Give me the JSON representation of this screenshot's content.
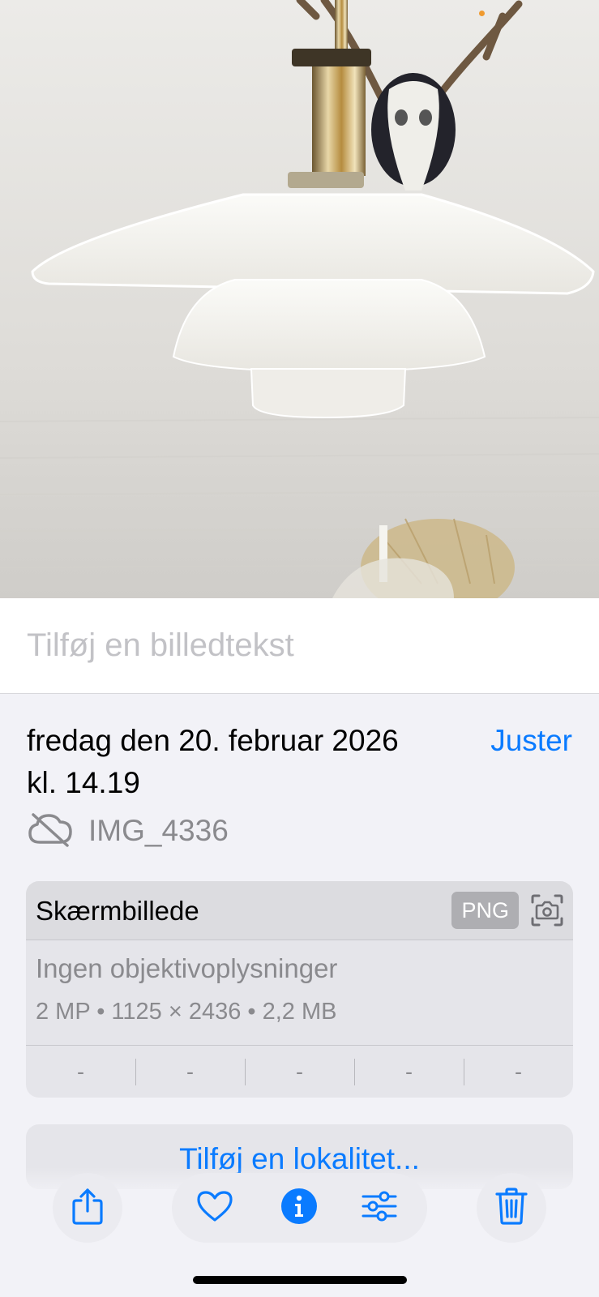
{
  "photo": {
    "description_icon": "pendant-lamp-photo"
  },
  "caption": {
    "placeholder": "Tilføj en billedtekst"
  },
  "info": {
    "date_line1": "fredag den 20. februar 2026",
    "date_line2": "kl. 14.19",
    "adjust_label": "Juster",
    "file_name": "IMG_4336"
  },
  "metadata": {
    "title": "Skærmbillede",
    "format_badge": "PNG",
    "lens": "Ingen objektivoplysninger",
    "specs": "2 MP • 1125 × 2436 • 2,2 MB",
    "exif": [
      "-",
      "-",
      "-",
      "-",
      "-"
    ]
  },
  "location": {
    "label": "Tilføj en lokalitet..."
  },
  "toolbar": {
    "share_icon": "share-icon",
    "favorite_icon": "heart-icon",
    "info_icon": "info-icon",
    "edit_icon": "sliders-icon",
    "delete_icon": "trash-icon"
  },
  "colors": {
    "accent": "#0a7bff",
    "secondary_text": "#8a8a8e",
    "placeholder": "#c2c2c6",
    "panel": "#f2f2f7",
    "card": "#e5e5ea"
  }
}
